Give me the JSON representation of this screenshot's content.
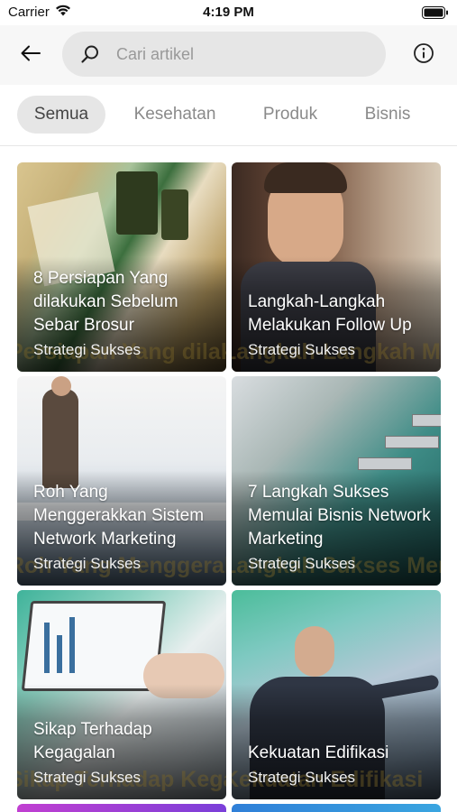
{
  "status_bar": {
    "carrier": "Carrier",
    "time": "4:19 PM"
  },
  "search": {
    "placeholder": "Cari artikel"
  },
  "tabs": [
    {
      "label": "Semua",
      "active": true
    },
    {
      "label": "Kesehatan",
      "active": false
    },
    {
      "label": "Produk",
      "active": false
    },
    {
      "label": "Bisnis",
      "active": false
    }
  ],
  "articles": [
    {
      "title": "8 Persiapan Yang dilakukan Sebelum Sebar Brosur",
      "category": "Strategi Sukses",
      "overlay_text": "Persiapan Yang dilakukan Sebelum Sebar Brosur"
    },
    {
      "title": "Langkah-Langkah Melakukan Follow Up",
      "category": "Strategi Sukses",
      "overlay_text": "Langkah-Langkah Melakukan Follow Up"
    },
    {
      "title": "Roh Yang Menggerakkan Sistem Network Marketing",
      "category": "Strategi Sukses",
      "overlay_text": "Roh Yang Menggerakkan Sistem Network Marketing"
    },
    {
      "title": "7 Langkah Sukses Memulai Bisnis Network Marketing",
      "category": "Strategi Sukses",
      "overlay_text": "Langkah Sukses Memulai Bisnis Network Marketing"
    },
    {
      "title": "Sikap Terhadap Kegagalan",
      "category": "Strategi Sukses",
      "overlay_text": "Sikap Terhadap Kegagalan"
    },
    {
      "title": "Kekuatan Edifikasi",
      "category": "Strategi Sukses",
      "overlay_text": "Kekuatan Edifikasi"
    }
  ],
  "colors": {
    "tab_active_bg": "#e6e6e6",
    "header_bg": "#f7f7f7",
    "search_bg": "#e6e6e6"
  },
  "icons": {
    "back": "arrow-left-icon",
    "search": "magnifier-icon",
    "info": "info-circle-icon",
    "wifi": "wifi-icon",
    "battery": "battery-icon"
  }
}
